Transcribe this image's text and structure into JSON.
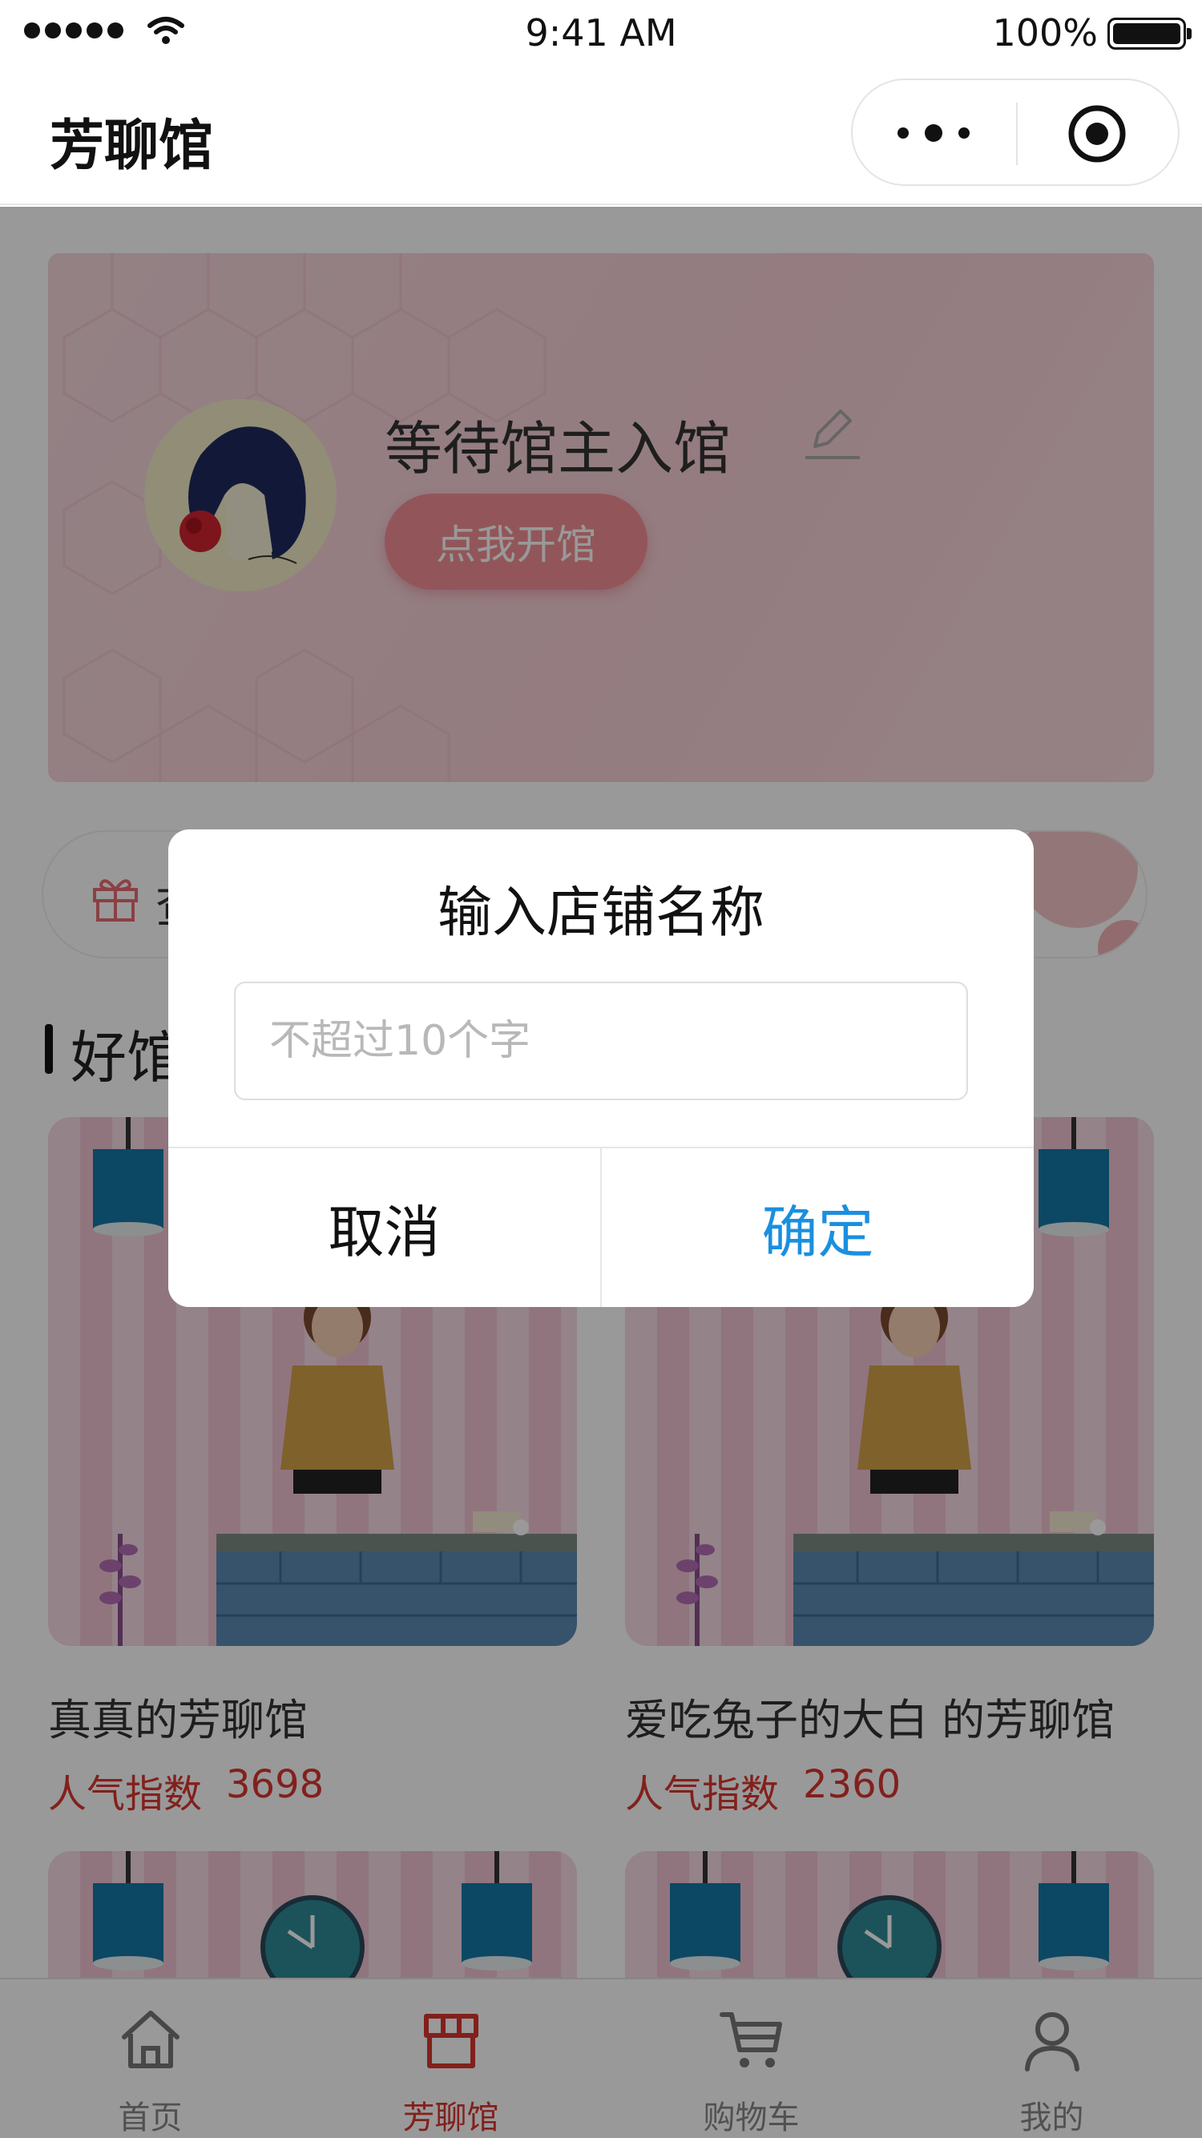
{
  "status_bar": {
    "time": "9:41 AM",
    "battery": "100%"
  },
  "nav": {
    "title": "芳聊馆"
  },
  "banner": {
    "shop_name": "等待馆主入馆",
    "open_button": "点我开馆"
  },
  "gift_bar": {
    "text": "查"
  },
  "section": {
    "title": "好馆"
  },
  "shops": [
    {
      "name": "真真的芳聊馆",
      "popularity_label": "人气指数",
      "popularity_value": "3698"
    },
    {
      "name": "爱吃兔子的大白 的芳聊馆",
      "popularity_label": "人气指数",
      "popularity_value": "2360"
    }
  ],
  "dialog": {
    "title": "输入店铺名称",
    "placeholder": "不超过10个字",
    "value": "",
    "cancel": "取消",
    "confirm": "确定"
  },
  "tabs": [
    {
      "label": "首页",
      "icon": "home-icon",
      "active": false
    },
    {
      "label": "芳聊馆",
      "icon": "shop-icon",
      "active": true
    },
    {
      "label": "购物车",
      "icon": "cart-icon",
      "active": false
    },
    {
      "label": "我的",
      "icon": "user-icon",
      "active": false
    }
  ],
  "colors": {
    "accent_red": "#d9362f",
    "confirm_blue": "#1a8fe0",
    "button_pink": "#f38f97"
  }
}
